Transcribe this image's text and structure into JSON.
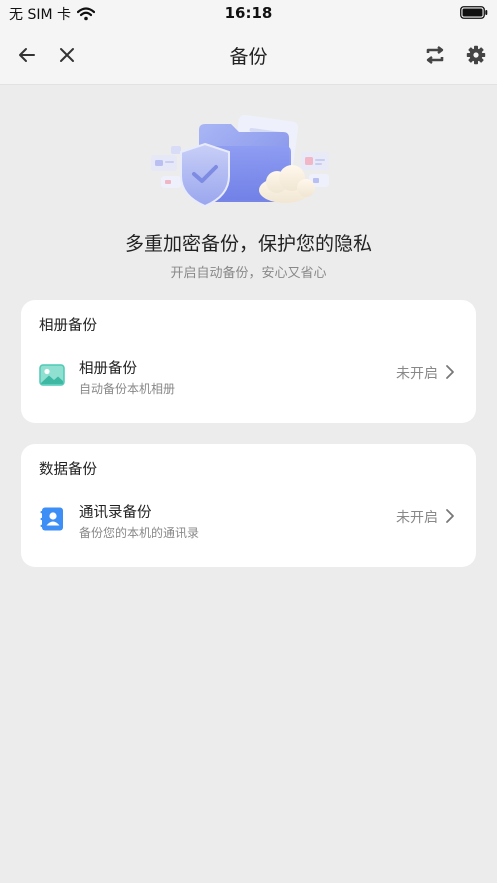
{
  "status_bar": {
    "carrier": "无 SIM 卡",
    "time": "16:18"
  },
  "nav": {
    "title": "备份",
    "back_icon": "arrow-left-icon",
    "close_icon": "close-icon",
    "switch_icon": "swap-icon",
    "settings_icon": "gear-icon"
  },
  "hero": {
    "title": "多重加密备份，保护您的隐私",
    "subtitle": "开启自动备份，安心又省心"
  },
  "sections": [
    {
      "title": "相册备份",
      "item": {
        "icon": "image-icon",
        "title": "相册备份",
        "description": "自动备份本机相册",
        "status": "未开启"
      }
    },
    {
      "title": "数据备份",
      "item": {
        "icon": "contacts-icon",
        "title": "通讯录备份",
        "description": "备份您的本机的通讯录",
        "status": "未开启"
      }
    }
  ],
  "colors": {
    "background": "#ececec",
    "card": "#ffffff",
    "accent_blue": "#3d8ef5",
    "accent_teal": "#4fc9b5",
    "muted_text": "#888888"
  }
}
